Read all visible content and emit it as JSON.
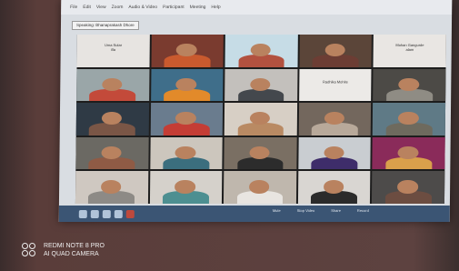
{
  "app_menu": {
    "items": [
      "File",
      "Edit",
      "View",
      "Zoom",
      "Audio & Video",
      "Participant",
      "Meeting",
      "Help"
    ]
  },
  "speaking_label": "Speaking: Bhanaprakash Dhore",
  "gallery": {
    "tiles": [
      {
        "name": "Uma Sutar\nilla",
        "bg": "#e7e4e1",
        "has_person": false
      },
      {
        "name": "",
        "bg": "#7a3b2f",
        "has_person": true,
        "shirt": "#c95a2e"
      },
      {
        "name": "",
        "bg": "#c6dce6",
        "has_person": true,
        "shirt": "#b2513f"
      },
      {
        "name": "",
        "bg": "#5b4539",
        "has_person": true,
        "shirt": "#6c3d34"
      },
      {
        "name": "Mohan Gangurde\nalam",
        "bg": "#e9e6e3",
        "has_person": false
      },
      {
        "name": "",
        "bg": "#9aa6a8",
        "has_person": true,
        "shirt": "#c34a3a"
      },
      {
        "name": "",
        "bg": "#3f6e8a",
        "has_person": true,
        "shirt": "#e28a2a"
      },
      {
        "name": "",
        "bg": "#c3c0bc",
        "has_person": true,
        "shirt": "#44484d"
      },
      {
        "name": "Radhika Mohite",
        "bg": "#eceae7",
        "has_person": false
      },
      {
        "name": "",
        "bg": "#4c4a46",
        "has_person": true,
        "shirt": "#8f8c84"
      },
      {
        "name": "",
        "bg": "#2f3a45",
        "has_person": true,
        "shirt": "#7a5646"
      },
      {
        "name": "",
        "bg": "#6a7c8e",
        "has_person": true,
        "shirt": "#c43d35"
      },
      {
        "name": "",
        "bg": "#d7cfc5",
        "has_person": true,
        "shirt": "#b98a63"
      },
      {
        "name": "",
        "bg": "#73675d",
        "has_person": true,
        "shirt": "#b8a99a"
      },
      {
        "name": "",
        "bg": "#5f7a86",
        "has_person": true,
        "shirt": "#6e6a5e"
      },
      {
        "name": "",
        "bg": "#6b6963",
        "has_person": true,
        "shirt": "#8f5b45"
      },
      {
        "name": "",
        "bg": "#ccc6bd",
        "has_person": true,
        "shirt": "#3b6e7e"
      },
      {
        "name": "",
        "bg": "#7a6f63",
        "has_person": true,
        "shirt": "#2c2c2c"
      },
      {
        "name": "",
        "bg": "#c9cdd1",
        "has_person": true,
        "shirt": "#3e2d6a"
      },
      {
        "name": "",
        "bg": "#8a2b5a",
        "has_person": true,
        "shirt": "#d9a04b"
      },
      {
        "name": "",
        "bg": "#cfc8c1",
        "has_person": true,
        "shirt": "#8d8a86"
      },
      {
        "name": "",
        "bg": "#d5d1cb",
        "has_person": true,
        "shirt": "#4d8f91"
      },
      {
        "name": "",
        "bg": "#bfb7ad",
        "has_person": true,
        "shirt": "#e8e5e1"
      },
      {
        "name": "",
        "bg": "#d9d6d2",
        "has_person": true,
        "shirt": "#2b2b2b"
      },
      {
        "name": "",
        "bg": "#4d4b4a",
        "has_person": true,
        "shirt": "#6c4d41"
      }
    ]
  },
  "toolbar": {
    "labels": [
      "Mute",
      "Stop Video",
      "Share",
      "Record"
    ]
  },
  "watermark": {
    "line1": "REDMI NOTE 8 PRO",
    "line2": "AI QUAD CAMERA"
  }
}
